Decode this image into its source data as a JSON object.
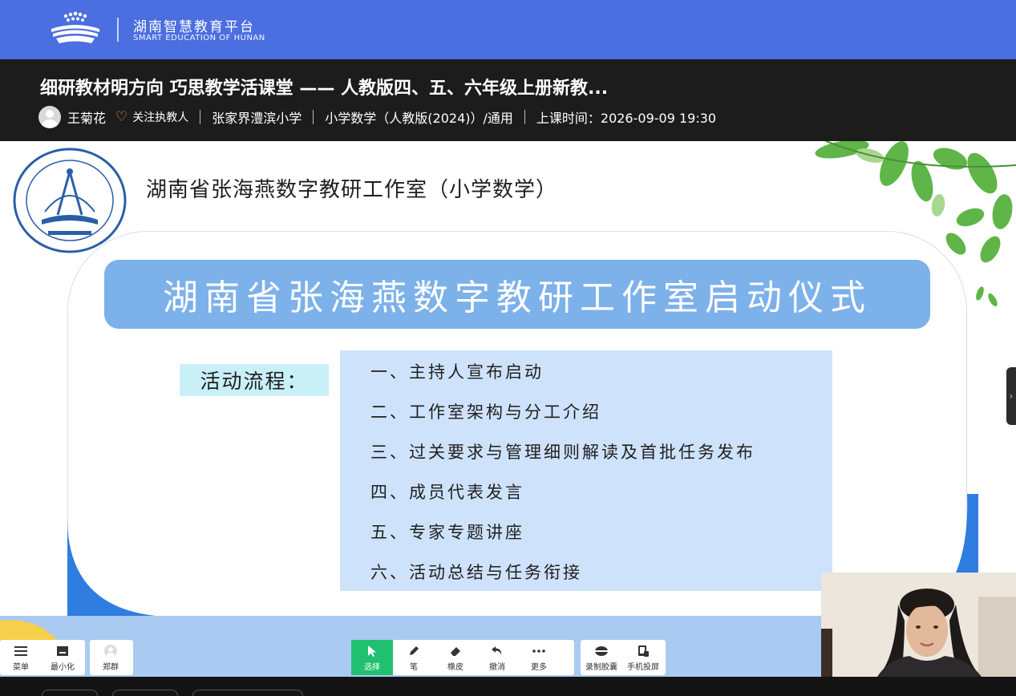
{
  "platform": {
    "name_cn": "湖南智慧教育平台",
    "name_en": "SMART EDUCATION OF HUNAN"
  },
  "course": {
    "title": "细研教材明方向 巧思教学活课堂 —— 人教版四、五、六年级上册新教...",
    "teacher": "王菊花",
    "follow_label": "关注执教人",
    "school": "张家界澧滨小学",
    "subject": "小学数学（人教版(2024)）/通用",
    "time_label": "上课时间：2026-09-09 19:30"
  },
  "slide": {
    "studio_title": "湖南省张海燕数字教研工作室（小学数学）",
    "banner": "湖南省张海燕数字教研工作室启动仪式",
    "flow_label": "活动流程：",
    "steps": [
      "一、主持人宣布启动",
      "二、工作室架构与分工介绍",
      "三、过关要求与管理细则解读及首批任务发布",
      "四、成员代表发言",
      "五、专家专题讲座",
      "六、活动总结与任务衔接"
    ]
  },
  "toolbar": {
    "left": [
      {
        "label": "菜单",
        "icon": "menu-icon"
      },
      {
        "label": "最小化",
        "icon": "minimize-icon"
      }
    ],
    "user": {
      "label": "郑群",
      "icon": "user-avatar-icon"
    },
    "tools": [
      {
        "label": "选择",
        "icon": "cursor-icon",
        "active": true
      },
      {
        "label": "笔",
        "icon": "pen-icon"
      },
      {
        "label": "橡皮",
        "icon": "eraser-icon"
      },
      {
        "label": "撤消",
        "icon": "undo-icon"
      },
      {
        "label": "更多",
        "icon": "more-icon"
      }
    ],
    "right": [
      {
        "label": "录制胶囊",
        "icon": "record-icon"
      },
      {
        "label": "手机投屏",
        "icon": "phone-cast-icon"
      }
    ]
  },
  "colors": {
    "brand_blue": "#4b6ee0",
    "banner_blue": "#7db1ea",
    "steps_bg": "#cfe2fb",
    "flow_label_bg": "#c9f0f7",
    "active_tool": "#20c070",
    "follow_heart": "#f39a2b"
  }
}
